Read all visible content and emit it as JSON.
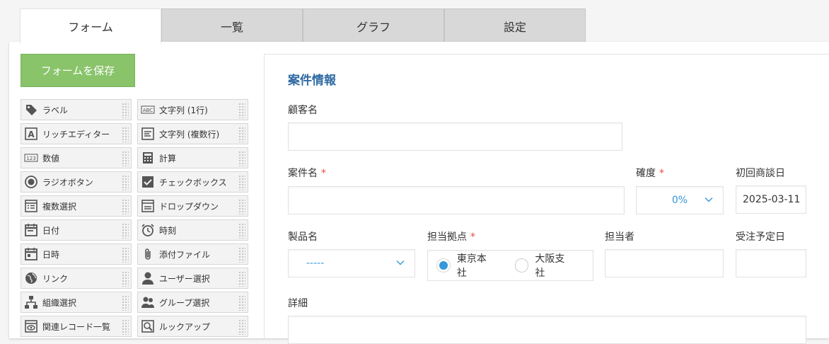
{
  "tabs": [
    {
      "label": "フォーム",
      "active": true
    },
    {
      "label": "一覧",
      "active": false
    },
    {
      "label": "グラフ",
      "active": false
    },
    {
      "label": "設定",
      "active": false
    }
  ],
  "save_button": {
    "label": "フォームを保存",
    "color": "#89c36a"
  },
  "palette": [
    {
      "label": "ラベル",
      "icon": "tag-icon"
    },
    {
      "label": "文字列 (1行)",
      "icon": "abc-text-icon"
    },
    {
      "label": "リッチエディター",
      "icon": "rich-editor-icon"
    },
    {
      "label": "文字列 (複数行)",
      "icon": "multiline-text-icon"
    },
    {
      "label": "数値",
      "icon": "number-123-icon"
    },
    {
      "label": "計算",
      "icon": "calculator-icon"
    },
    {
      "label": "ラジオボタン",
      "icon": "radio-icon"
    },
    {
      "label": "チェックボックス",
      "icon": "checkbox-icon"
    },
    {
      "label": "複数選択",
      "icon": "multi-select-icon"
    },
    {
      "label": "ドロップダウン",
      "icon": "dropdown-icon"
    },
    {
      "label": "日付",
      "icon": "calendar-icon"
    },
    {
      "label": "時刻",
      "icon": "alarm-clock-icon"
    },
    {
      "label": "日時",
      "icon": "calendar-time-icon"
    },
    {
      "label": "添付ファイル",
      "icon": "paperclip-icon"
    },
    {
      "label": "リンク",
      "icon": "globe-icon"
    },
    {
      "label": "ユーザー選択",
      "icon": "user-icon"
    },
    {
      "label": "組織選択",
      "icon": "org-chart-icon"
    },
    {
      "label": "グループ選択",
      "icon": "group-icon"
    },
    {
      "label": "関連レコード一覧",
      "icon": "related-records-icon"
    },
    {
      "label": "ルックアップ",
      "icon": "lookup-icon"
    }
  ],
  "form": {
    "section_title": "案件情報",
    "customer_label": "顧客名",
    "customer_value": "",
    "deal_label": "案件名",
    "deal_value": "",
    "certainty_label": "確度",
    "certainty_value": "0%",
    "first_meeting_label": "初回商談日",
    "first_meeting_value": "2025-03-11",
    "product_label": "製品名",
    "product_value": "-----",
    "office_label": "担当拠点",
    "office_options": [
      "東京本社",
      "大阪支社"
    ],
    "office_selected": "東京本社",
    "owner_label": "担当者",
    "owner_value": "",
    "order_date_label": "受注予定日",
    "order_date_value": "",
    "details_label": "詳細",
    "details_value": ""
  },
  "colors": {
    "accent": "#3498db",
    "title": "#2f6aa3",
    "required": "#e74c3c"
  }
}
